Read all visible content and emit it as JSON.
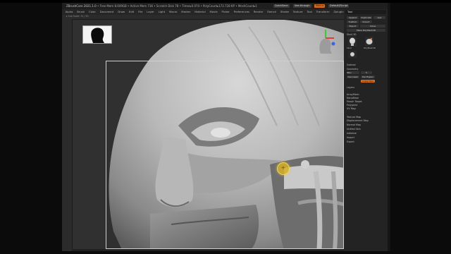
{
  "app": {
    "title": "ZBrushCore 2021.1.0",
    "stats": "• Free Mem 8.609GB • Active Mem 736 • Scratch Disk 78 • Timer▸0.074 • PolyCount▸173.728 KP • MeshCount▸1",
    "buttons": {
      "quicksave": "QuickSave",
      "see_through": "See-through",
      "menus": "Menus",
      "script": "DefaultZScript"
    }
  },
  "menubar": {
    "items": [
      "Alpha",
      "Brush",
      "Color",
      "Document",
      "Draw",
      "Edit",
      "File",
      "Layer",
      "Light",
      "Macro",
      "Marker",
      "Material",
      "Movie",
      "Picker",
      "Preferences",
      "Render",
      "Stencil",
      "Stroke",
      "Texture",
      "Tool",
      "Transform",
      "Zplugin",
      "Zscript",
      "Help"
    ]
  },
  "status": {
    "text": "▸ Sub Scale: 31 / 50"
  },
  "panel": {
    "title": "Tool",
    "buttons": [
      "Append",
      "Duplicate",
      "Subtool",
      "Import",
      "Export",
      "Clone",
      "Make PolyMesh3D",
      "Goz"
    ],
    "tool_label": "Skull.3D",
    "subtool_labels": [
      "Skull",
      "PolyMesh3D"
    ],
    "sections": [
      "Subtool",
      "Geometry",
      "Layers",
      "ArrayMesh",
      "NanoMesh",
      "Morph Target",
      "Polypaint",
      "UV Map",
      "Texture Map",
      "Displacement Map",
      "Normal Map",
      "Unified Skin",
      "Initialize",
      "Import",
      "Export"
    ],
    "sliders": [
      {
        "label": "SDiv",
        "value": "5"
      },
      {
        "label": "Del Lower",
        "value": "Del Higher"
      }
    ],
    "orange_button": "Lower Res"
  },
  "colors": {
    "accent": "#d86a1a",
    "viewport_bg": "#303030",
    "panel_bg": "#232323",
    "brush": "#d6b028"
  }
}
